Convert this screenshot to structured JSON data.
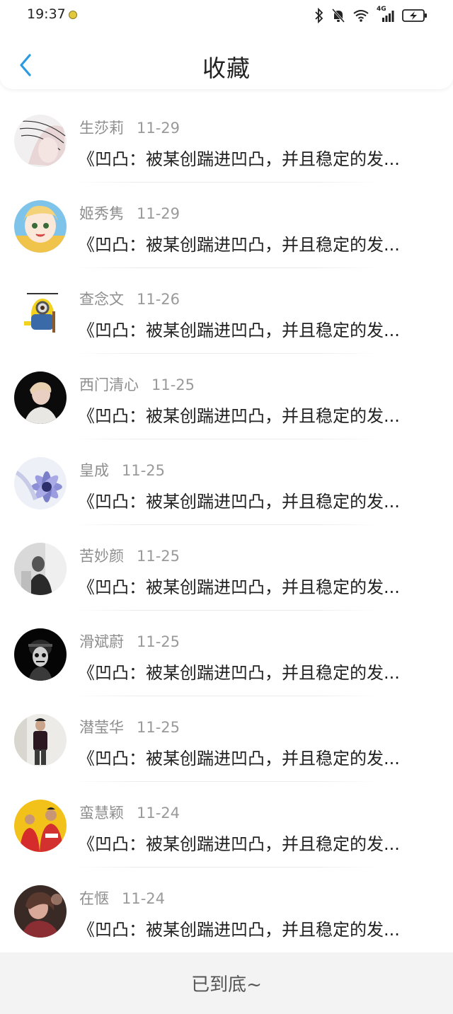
{
  "status_bar": {
    "time": "19:37",
    "network_label": "4G"
  },
  "header": {
    "title": "收藏",
    "back_icon": "chevron-left-icon",
    "accent": "#2a9be0"
  },
  "favorites": [
    {
      "name": "生莎莉",
      "date": "11-29",
      "text": "《凹凸：被某创踹进凹凸，并且稳定的发..."
    },
    {
      "name": "姬秀隽",
      "date": "11-29",
      "text": "《凹凸：被某创踹进凹凸，并且稳定的发..."
    },
    {
      "name": "查念文",
      "date": "11-26",
      "text": "《凹凸：被某创踹进凹凸，并且稳定的发..."
    },
    {
      "name": "西门清心",
      "date": "11-25",
      "text": "《凹凸：被某创踹进凹凸，并且稳定的发..."
    },
    {
      "name": "皇成",
      "date": "11-25",
      "text": "《凹凸：被某创踹进凹凸，并且稳定的发..."
    },
    {
      "name": "苦妙颜",
      "date": "11-25",
      "text": "《凹凸：被某创踹进凹凸，并且稳定的发..."
    },
    {
      "name": "滑斌蔚",
      "date": "11-25",
      "text": "《凹凸：被某创踹进凹凸，并且稳定的发..."
    },
    {
      "name": "潜莹华",
      "date": "11-25",
      "text": "《凹凸：被某创踹进凹凸，并且稳定的发..."
    },
    {
      "name": "蛮慧颖",
      "date": "11-24",
      "text": "《凹凸：被某创踹进凹凸，并且稳定的发..."
    },
    {
      "name": "在惬",
      "date": "11-24",
      "text": "《凹凸：被某创踹进凹凸，并且稳定的发..."
    }
  ],
  "footer": {
    "end_text": "已到底~"
  }
}
